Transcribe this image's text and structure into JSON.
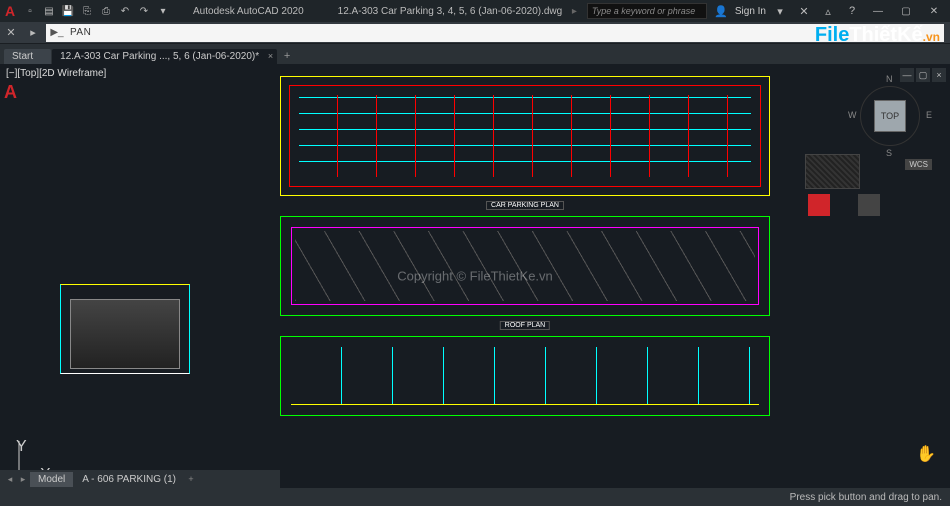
{
  "titlebar": {
    "app_name": "Autodesk AutoCAD 2020",
    "file_name": "12.A-303 Car Parking 3, 4, 5, 6 (Jan-06-2020).dwg",
    "search_placeholder": "Type a keyword or phrase",
    "sign_in": "Sign In"
  },
  "command": {
    "current": "PAN"
  },
  "tabs": {
    "start": "Start",
    "doc1": "12.A-303 Car Parking ..., 5, 6 (Jan-06-2020)*"
  },
  "viewport": {
    "view_label": "[−][Top][2D Wireframe]",
    "viewcube_face": "TOP",
    "viewcube_dirs": {
      "n": "N",
      "s": "S",
      "e": "E",
      "w": "W"
    },
    "wcs": "WCS",
    "ucs": {
      "x": "X",
      "y": "Y"
    }
  },
  "drawings": {
    "plan1_label": "CAR PARKING PLAN",
    "plan2_label": "ROOF PLAN"
  },
  "model_tabs": {
    "model": "Model",
    "layout1": "A - 606 PARKING (1)"
  },
  "status": {
    "msg": "Press pick button and drag to pan."
  },
  "watermark": {
    "logo1": "File",
    "logo2": "ThiếtKế",
    "logo3": ".vn",
    "copyright": "Copyright © FileThietKe.vn"
  }
}
